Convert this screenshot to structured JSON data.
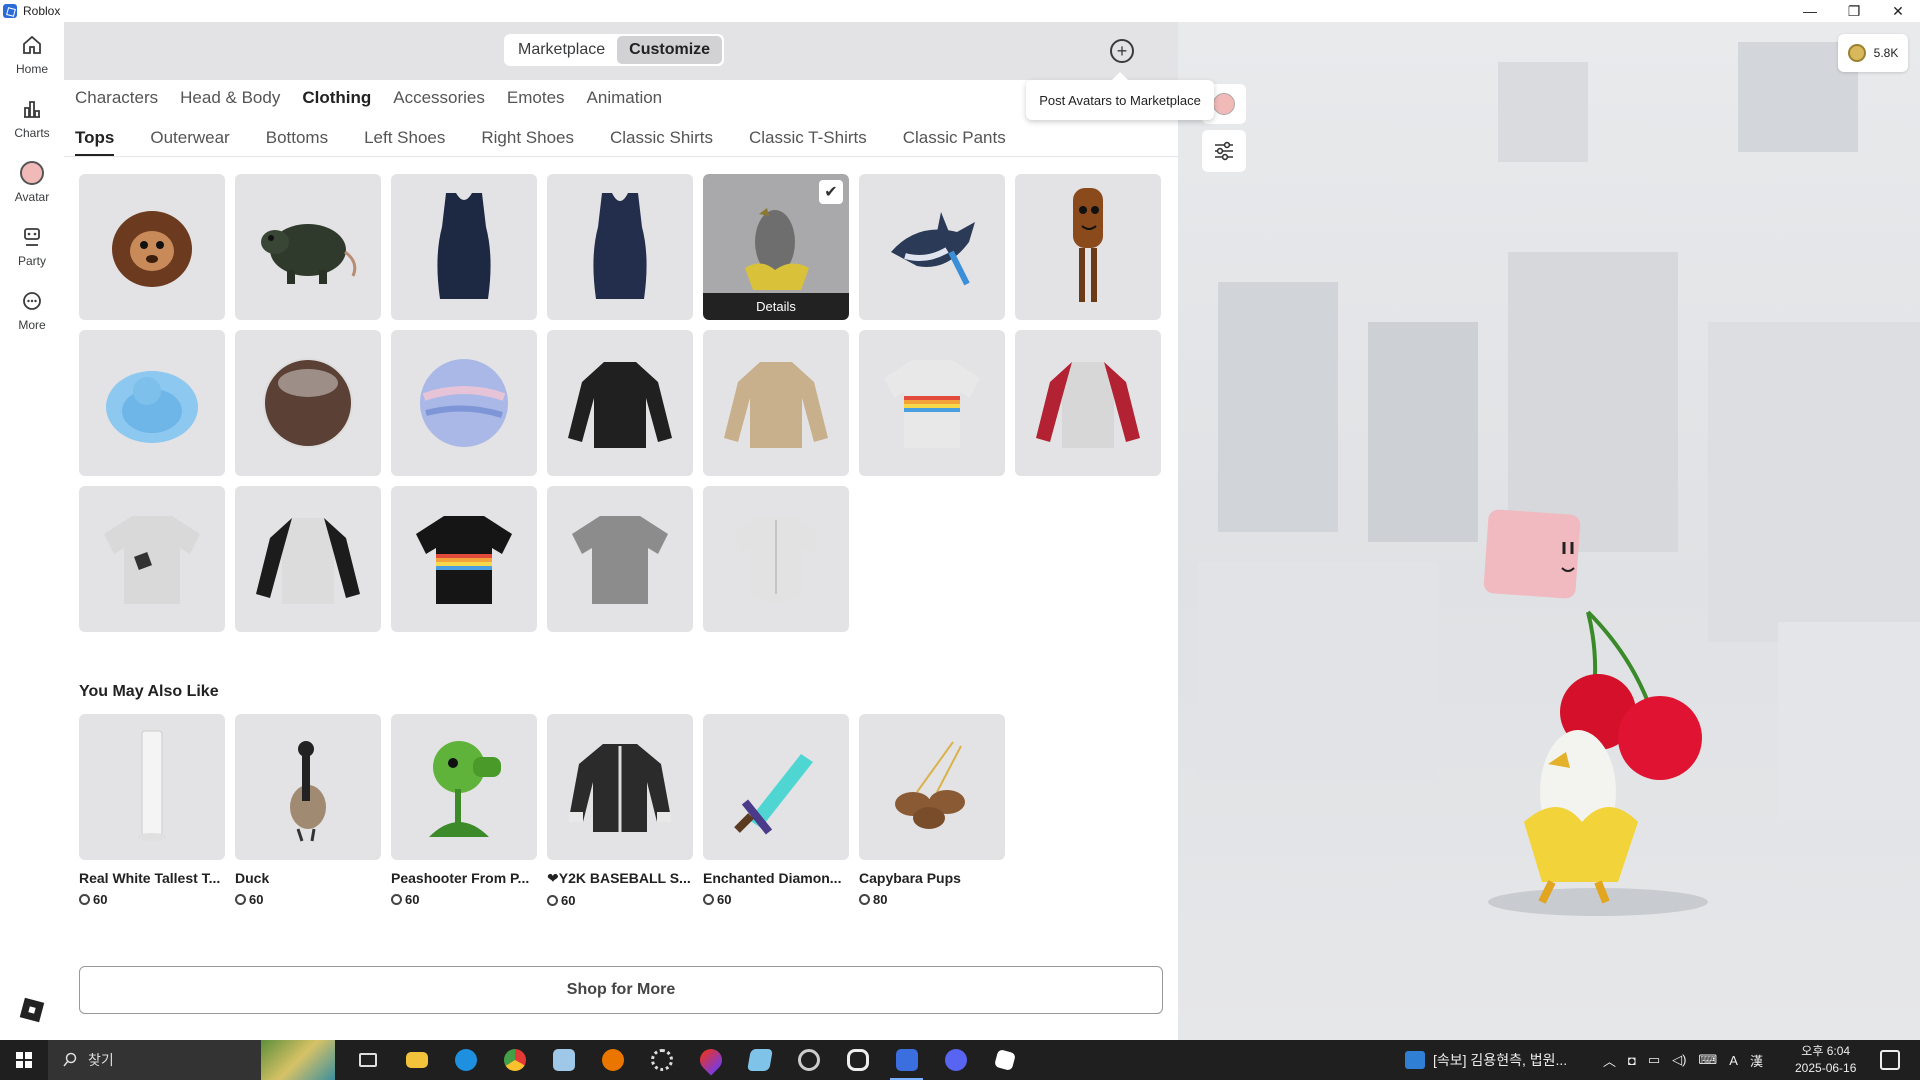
{
  "window": {
    "title": "Roblox",
    "controls": [
      "—",
      "❐",
      "✕"
    ]
  },
  "nav": [
    {
      "label": "Home",
      "icon": "home-icon"
    },
    {
      "label": "Charts",
      "icon": "charts-icon"
    },
    {
      "label": "Avatar",
      "icon": "avatar-icon"
    },
    {
      "label": "Party",
      "icon": "party-icon"
    },
    {
      "label": "More",
      "icon": "more-icon"
    }
  ],
  "header": {
    "segments": [
      "Marketplace",
      "Customize"
    ],
    "active_segment": "Customize",
    "plus_icon": "+",
    "tooltip": "Post Avatars to Marketplace"
  },
  "categories": [
    "Characters",
    "Head & Body",
    "Clothing",
    "Accessories",
    "Emotes",
    "Animation"
  ],
  "active_category": "Clothing",
  "subtabs": [
    "Tops",
    "Outerwear",
    "Bottoms",
    "Left Shoes",
    "Right Shoes",
    "Classic Shirts",
    "Classic T-Shirts",
    "Classic Pants"
  ],
  "active_subtab": "Tops",
  "grid_items": [
    {
      "kind": "capybara-brown",
      "selected": false
    },
    {
      "kind": "rat",
      "selected": false
    },
    {
      "kind": "navy-tank",
      "selected": false
    },
    {
      "kind": "navy-tank",
      "selected": false
    },
    {
      "kind": "banana-duck",
      "selected": true
    },
    {
      "kind": "orca",
      "selected": false
    },
    {
      "kind": "bread-man",
      "selected": false
    },
    {
      "kind": "blue-duck-bubble",
      "selected": false
    },
    {
      "kind": "dark-sphere",
      "selected": false
    },
    {
      "kind": "swirl-sphere",
      "selected": false
    },
    {
      "kind": "black-sweater",
      "selected": false
    },
    {
      "kind": "tan-sweater",
      "selected": false
    },
    {
      "kind": "rainbow-tee-white",
      "selected": false
    },
    {
      "kind": "red-raglan",
      "selected": false
    },
    {
      "kind": "white-tee-pocket",
      "selected": false
    },
    {
      "kind": "black-raglan",
      "selected": false
    },
    {
      "kind": "rainbow-tee-black",
      "selected": false
    },
    {
      "kind": "gray-tee",
      "selected": false
    },
    {
      "kind": "white-knot-shirt",
      "selected": false
    }
  ],
  "details_label": "Details",
  "check_icon": "✔",
  "recommendations": {
    "title": "You May Also Like",
    "items": [
      {
        "name": "Real White Tallest T...",
        "price": "60",
        "kind": "white-tower"
      },
      {
        "name": "Duck",
        "price": "60",
        "kind": "goose"
      },
      {
        "name": "Peashooter From P...",
        "price": "60",
        "kind": "peashooter"
      },
      {
        "name": "❤Y2K BASEBALL S...",
        "price": "60",
        "kind": "baseball-jacket"
      },
      {
        "name": "Enchanted Diamon...",
        "price": "60",
        "kind": "diamond-sword"
      },
      {
        "name": "Capybara Pups",
        "price": "80",
        "kind": "capybara-pups"
      }
    ]
  },
  "shop_button": "Shop for More",
  "viewport": {
    "robux_balance": "5.8K"
  },
  "taskbar": {
    "search_placeholder": "찾기",
    "news_text": "[속보] 김용현측, 법원...",
    "time": "오후 6:04",
    "date": "2025-06-16",
    "ime": "A",
    "ime2": "漢"
  }
}
